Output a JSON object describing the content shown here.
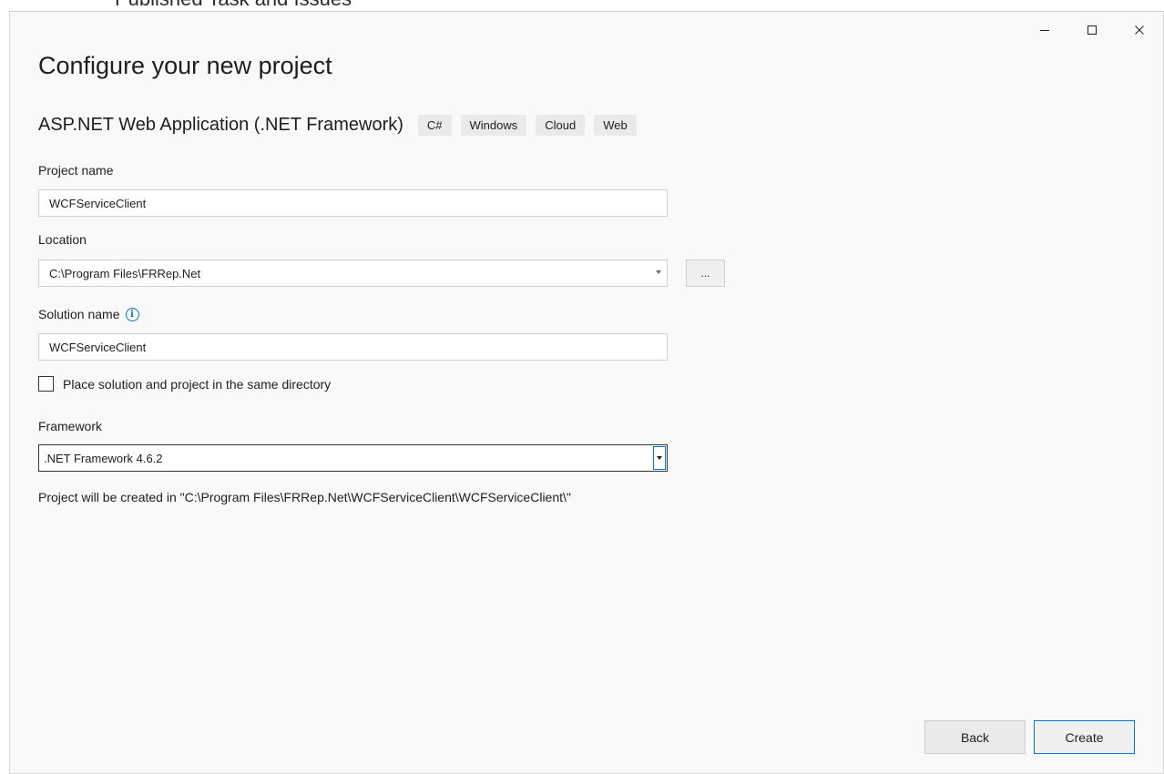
{
  "background": {
    "text": "Published Task and Issues"
  },
  "window_controls": {
    "minimize": "—",
    "maximize": "☐",
    "close": "✕"
  },
  "title": "Configure your new project",
  "template": {
    "name": "ASP.NET Web Application (.NET Framework)",
    "tags": [
      "C#",
      "Windows",
      "Cloud",
      "Web"
    ]
  },
  "project_name": {
    "label": "Project name",
    "value": "WCFServiceClient"
  },
  "location": {
    "label": "Location",
    "value": "C:\\Program Files\\FRRep.Net",
    "browse_label": "..."
  },
  "solution_name": {
    "label": "Solution name",
    "value": "WCFServiceClient"
  },
  "same_directory": {
    "label": "Place solution and project in the same directory",
    "checked": false
  },
  "framework": {
    "label": "Framework",
    "value": ".NET Framework 4.6.2"
  },
  "path_info": "Project will be created in \"C:\\Program Files\\FRRep.Net\\WCFServiceClient\\WCFServiceClient\\\"",
  "buttons": {
    "back": "Back",
    "create": "Create"
  },
  "colors": {
    "accent": "#0078d7",
    "info": "#0e70c0",
    "window_bg": "#f9f9f9"
  }
}
